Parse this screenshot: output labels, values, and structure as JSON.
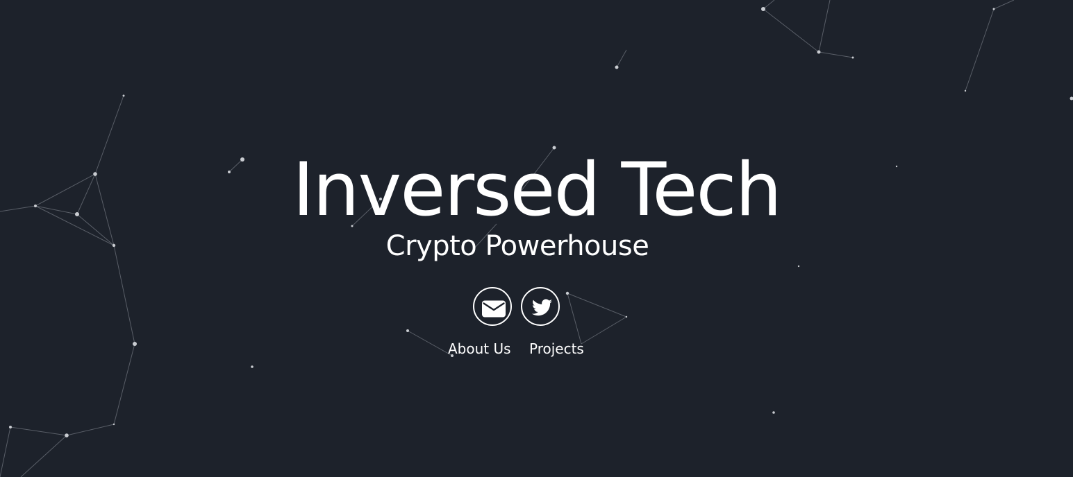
{
  "hero": {
    "title": "Inversed Tech",
    "tagline": "Crypto Powerhouse"
  },
  "social": [
    {
      "icon": "envelope-icon"
    },
    {
      "icon": "twitter-bird-icon"
    }
  ],
  "nav": {
    "about_label": "About Us",
    "projects_label": "Projects"
  },
  "colors": {
    "background": "#1d222b",
    "foreground": "#ffffff",
    "network_line": "#8a9099"
  }
}
